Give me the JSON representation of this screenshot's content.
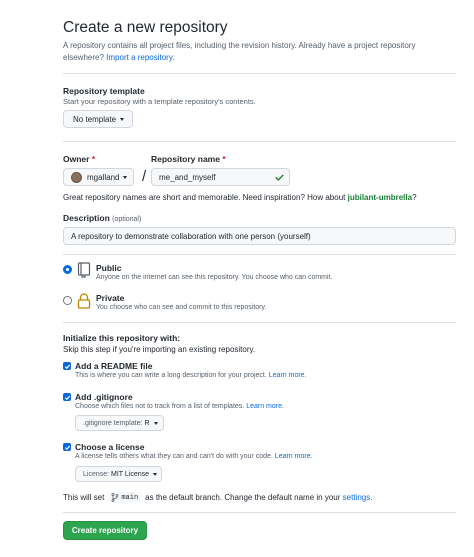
{
  "header": {
    "title": "Create a new repository",
    "description": "A repository contains all project files, including the revision history. Already have a project repository",
    "description_line2": "elsewhere?",
    "import_link": "Import a repository."
  },
  "template": {
    "label": "Repository template",
    "description": "Start your repository with a template repository's contents.",
    "button": "No template"
  },
  "owner": {
    "label": "Owner",
    "required": "*",
    "value": "mgalland"
  },
  "slash": "/",
  "repo_name": {
    "label": "Repository name",
    "required": "*",
    "value": "me_and_myself"
  },
  "suggestion": {
    "text": "Great repository names are short and memorable. Need inspiration? How about",
    "name": "jubilant-umbrella",
    "end": "?"
  },
  "description_field": {
    "label": "Description",
    "optional": "(optional)",
    "value": "A repository to demonstrate collaboration with one person (yourself)"
  },
  "visibility": {
    "public_label": "Public",
    "public_desc": "Anyone on the internet can see this repository. You choose who can commit.",
    "private_label": "Private",
    "private_desc": "You choose who can see and commit to this repository.",
    "selected": "public"
  },
  "init": {
    "heading": "Initialize this repository with:",
    "skip": "Skip this step if you're importing an existing repository.",
    "readme_label": "Add a README file",
    "readme_desc": "This is where you can write a long description for your project.",
    "readme_link": "Learn more.",
    "readme_checked": true,
    "gitignore_label": "Add .gitignore",
    "gitignore_desc": "Choose which files not to track from a list of templates.",
    "gitignore_link": "Learn more.",
    "gitignore_checked": true,
    "gitignore_prefix": ".gitignore template:",
    "gitignore_value": "R",
    "license_label": "Choose a license",
    "license_desc": "A license tells others what they can and can't do with your code.",
    "license_link": "Learn more.",
    "license_checked": true,
    "license_prefix": "License:",
    "license_value": "MIT License"
  },
  "branch": {
    "prefix": "This will set",
    "name": "main",
    "middle": "as the default branch. Change the default name in your",
    "settings_link": "settings",
    "end": "."
  },
  "submit": "Create repository",
  "colors": {
    "primary": "#2da44e",
    "link": "#0969da",
    "required": "#cf222e",
    "check": "#1a7f37",
    "private_icon": "#bf8700"
  }
}
